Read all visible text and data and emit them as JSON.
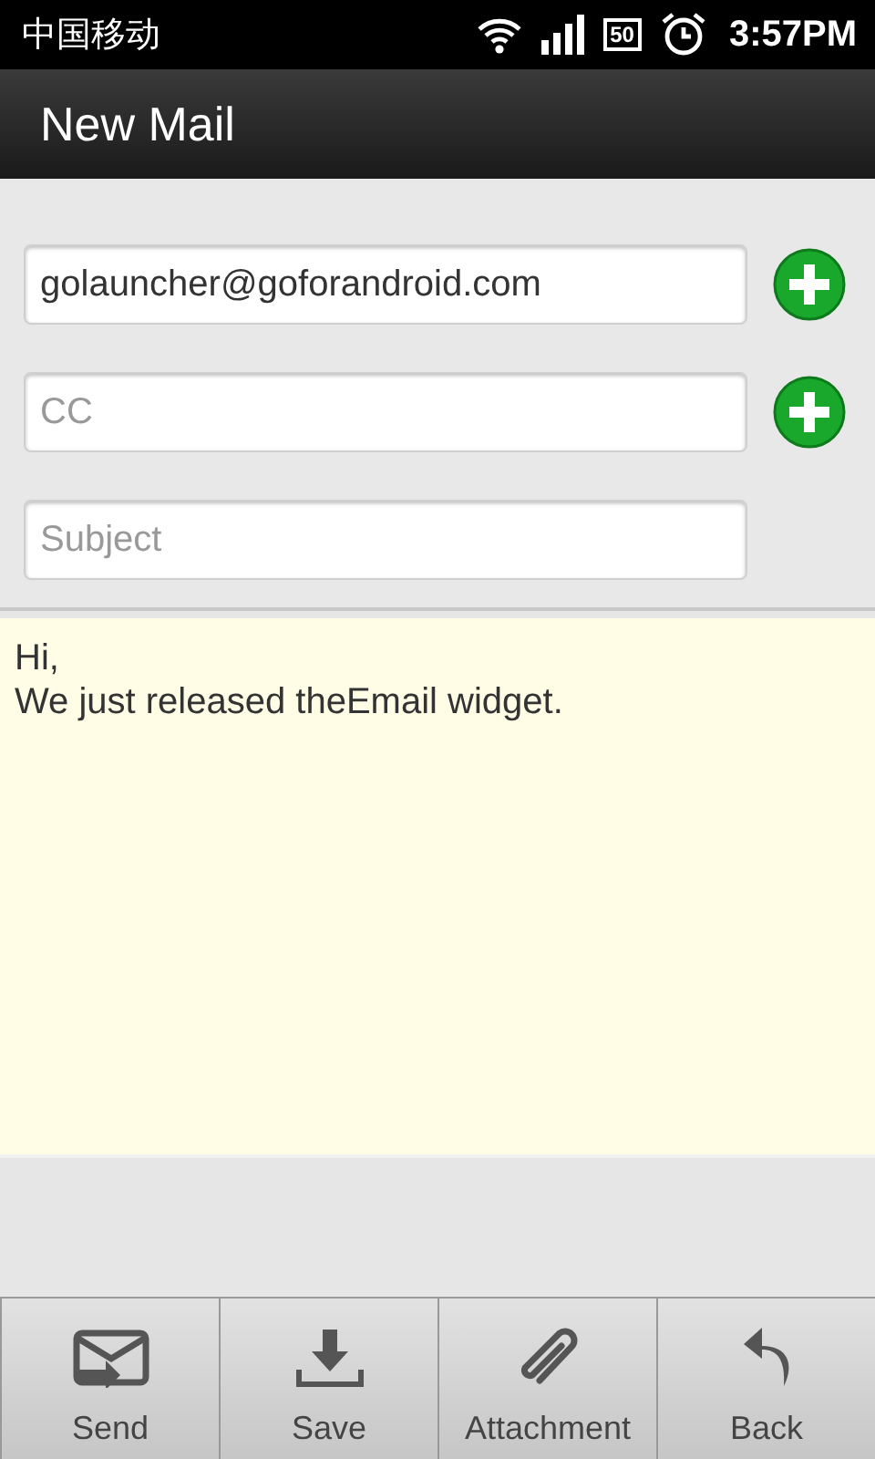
{
  "status_bar": {
    "carrier": "中国移动",
    "battery": "50",
    "time": "3:57PM"
  },
  "title_bar": {
    "title": "New Mail"
  },
  "fields": [
    {
      "value": "golauncher@goforandroid.com",
      "add_button": true
    },
    {
      "placeholder": "CC",
      "add_button": true
    },
    {
      "placeholder": "Subject",
      "add_button": false
    }
  ],
  "body": {
    "value": "Hi,\nWe just released theEmail widget."
  },
  "toolbar": [
    {
      "kind": "send",
      "label": "Send"
    },
    {
      "kind": "save",
      "label": "Save"
    },
    {
      "kind": "attach",
      "label": "Attachment"
    },
    {
      "kind": "back",
      "label": "Back"
    }
  ]
}
